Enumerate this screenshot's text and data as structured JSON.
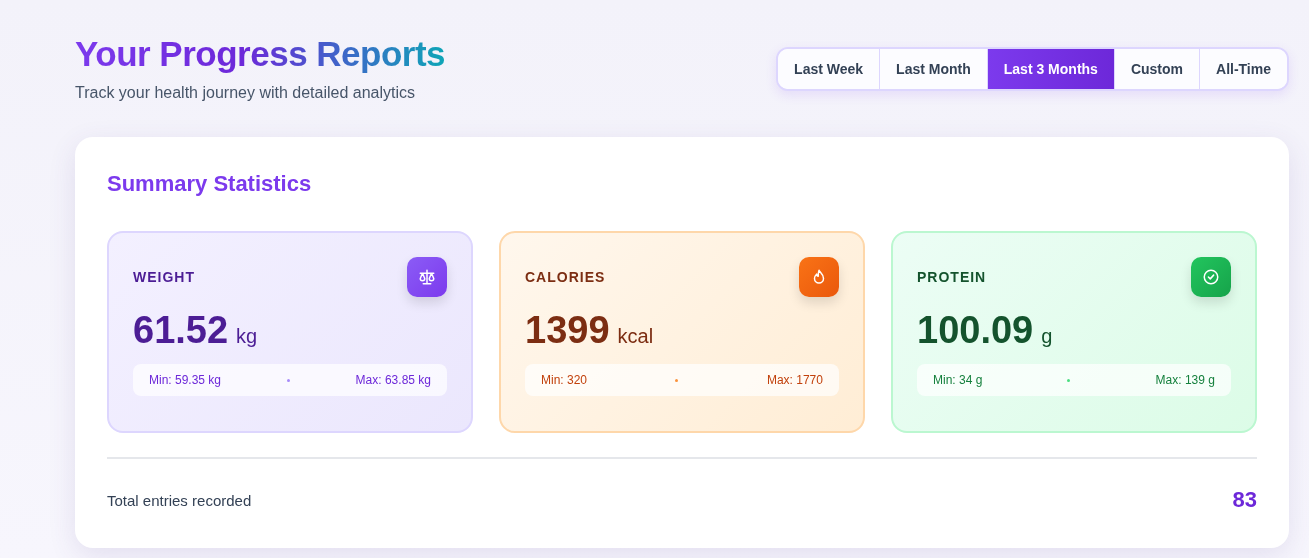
{
  "header": {
    "title": "Your Progress Reports",
    "subtitle": "Track your health journey with detailed analytics"
  },
  "ranges": [
    {
      "label": "Last Week",
      "selected": false
    },
    {
      "label": "Last Month",
      "selected": false
    },
    {
      "label": "Last 3 Months",
      "selected": true
    },
    {
      "label": "Custom",
      "selected": false
    },
    {
      "label": "All-Time",
      "selected": false
    }
  ],
  "summary": {
    "title": "Summary Statistics",
    "stats": [
      {
        "kind": "weight",
        "label": "WEIGHT",
        "value": "61.52",
        "unit": "kg",
        "min": "Min: 59.35 kg",
        "max": "Max: 63.85 kg"
      },
      {
        "kind": "calories",
        "label": "CALORIES",
        "value": "1399",
        "unit": "kcal",
        "min": "Min: 320",
        "max": "Max: 1770"
      },
      {
        "kind": "protein",
        "label": "PROTEIN",
        "value": "100.09",
        "unit": "g",
        "min": "Min: 34 g",
        "max": "Max: 139 g"
      }
    ],
    "total_label": "Total entries recorded",
    "total_value": "83"
  }
}
